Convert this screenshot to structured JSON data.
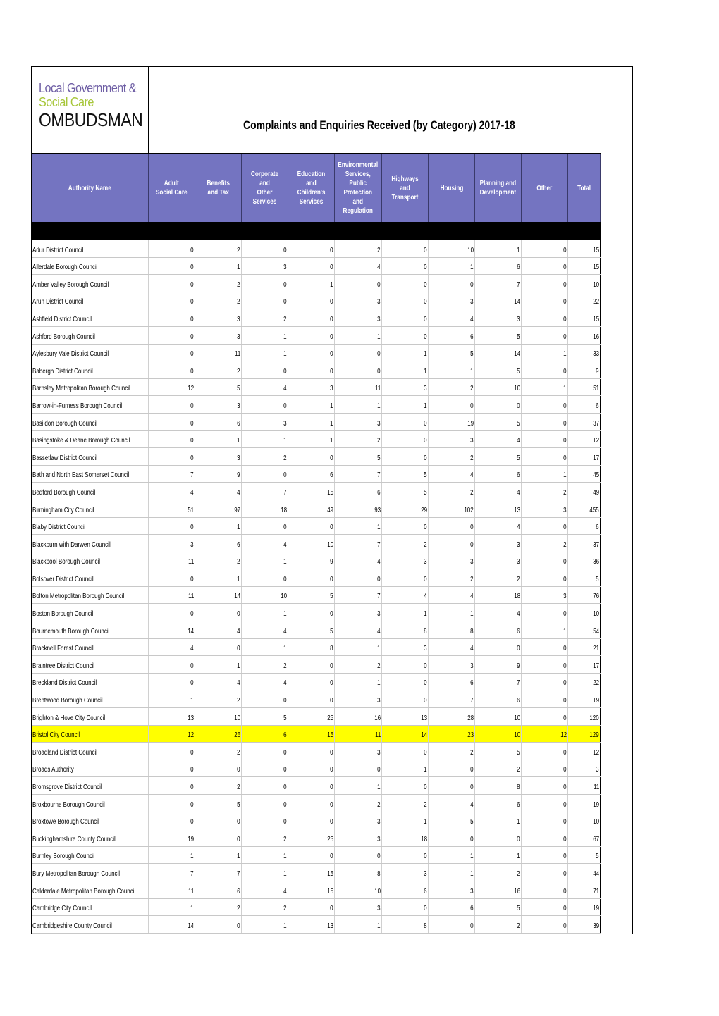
{
  "logo": {
    "line1": "Local Government &",
    "line2": "Social Care",
    "line3": "OMBUDSMAN",
    "colors": {
      "line1": "#6f5fa5",
      "line2": "#a7c63a",
      "line3": "#111111"
    }
  },
  "title": "Complaints and Enquiries Received (by Category) 2017-18",
  "colors": {
    "header_bg": "#7474c1",
    "highlight": "#ffff00"
  },
  "columns": [
    "Authority Name",
    "Adult Social Care",
    "Benefits and Tax",
    "Corporate and Other Services",
    "Education and Children's Services",
    "Environmental Services, Public Protection and Regulation",
    "Highways and Transport",
    "Housing",
    "Planning and Development",
    "Other",
    "Total"
  ],
  "rows": [
    {
      "name": "Adur District Council",
      "values": [
        0,
        2,
        0,
        0,
        2,
        0,
        10,
        1,
        0,
        15
      ]
    },
    {
      "name": "Allerdale Borough Council",
      "values": [
        0,
        1,
        3,
        0,
        4,
        0,
        1,
        6,
        0,
        15
      ]
    },
    {
      "name": "Amber Valley Borough Council",
      "values": [
        0,
        2,
        0,
        1,
        0,
        0,
        0,
        7,
        0,
        10
      ]
    },
    {
      "name": "Arun District Council",
      "values": [
        0,
        2,
        0,
        0,
        3,
        0,
        3,
        14,
        0,
        22
      ]
    },
    {
      "name": "Ashfield District Council",
      "values": [
        0,
        3,
        2,
        0,
        3,
        0,
        4,
        3,
        0,
        15
      ]
    },
    {
      "name": "Ashford Borough Council",
      "values": [
        0,
        3,
        1,
        0,
        1,
        0,
        6,
        5,
        0,
        16
      ]
    },
    {
      "name": "Aylesbury Vale District Council",
      "values": [
        0,
        11,
        1,
        0,
        0,
        1,
        5,
        14,
        1,
        33
      ]
    },
    {
      "name": "Babergh District Council",
      "values": [
        0,
        2,
        0,
        0,
        0,
        1,
        1,
        5,
        0,
        9
      ]
    },
    {
      "name": "Barnsley Metropolitan Borough Council",
      "values": [
        12,
        5,
        4,
        3,
        11,
        3,
        2,
        10,
        1,
        51
      ]
    },
    {
      "name": "Barrow-in-Furness Borough Council",
      "values": [
        0,
        3,
        0,
        1,
        1,
        1,
        0,
        0,
        0,
        6
      ]
    },
    {
      "name": "Basildon Borough Council",
      "values": [
        0,
        6,
        3,
        1,
        3,
        0,
        19,
        5,
        0,
        37
      ]
    },
    {
      "name": "Basingstoke & Deane Borough Council",
      "values": [
        0,
        1,
        1,
        1,
        2,
        0,
        3,
        4,
        0,
        12
      ]
    },
    {
      "name": "Bassetlaw District Council",
      "values": [
        0,
        3,
        2,
        0,
        5,
        0,
        2,
        5,
        0,
        17
      ]
    },
    {
      "name": "Bath and North East Somerset Council",
      "values": [
        7,
        9,
        0,
        6,
        7,
        5,
        4,
        6,
        1,
        45
      ]
    },
    {
      "name": "Bedford Borough Council",
      "values": [
        4,
        4,
        7,
        15,
        6,
        5,
        2,
        4,
        2,
        49
      ]
    },
    {
      "name": "Birmingham City Council",
      "values": [
        51,
        97,
        18,
        49,
        93,
        29,
        102,
        13,
        3,
        455
      ]
    },
    {
      "name": "Blaby District Council",
      "values": [
        0,
        1,
        0,
        0,
        1,
        0,
        0,
        4,
        0,
        6
      ]
    },
    {
      "name": "Blackburn with Darwen Council",
      "values": [
        3,
        6,
        4,
        10,
        7,
        2,
        0,
        3,
        2,
        37
      ]
    },
    {
      "name": "Blackpool Borough Council",
      "values": [
        11,
        2,
        1,
        9,
        4,
        3,
        3,
        3,
        0,
        36
      ]
    },
    {
      "name": "Bolsover District Council",
      "values": [
        0,
        1,
        0,
        0,
        0,
        0,
        2,
        2,
        0,
        5
      ]
    },
    {
      "name": "Bolton Metropolitan Borough Council",
      "values": [
        11,
        14,
        10,
        5,
        7,
        4,
        4,
        18,
        3,
        76
      ]
    },
    {
      "name": "Boston Borough Council",
      "values": [
        0,
        0,
        1,
        0,
        3,
        1,
        1,
        4,
        0,
        10
      ]
    },
    {
      "name": "Bournemouth Borough Council",
      "values": [
        14,
        4,
        4,
        5,
        4,
        8,
        8,
        6,
        1,
        54
      ]
    },
    {
      "name": "Bracknell Forest Council",
      "values": [
        4,
        0,
        1,
        8,
        1,
        3,
        4,
        0,
        0,
        21
      ]
    },
    {
      "name": "Braintree District Council",
      "values": [
        0,
        1,
        2,
        0,
        2,
        0,
        3,
        9,
        0,
        17
      ]
    },
    {
      "name": "Breckland District Council",
      "values": [
        0,
        4,
        4,
        0,
        1,
        0,
        6,
        7,
        0,
        22
      ]
    },
    {
      "name": "Brentwood Borough Council",
      "values": [
        1,
        2,
        0,
        0,
        3,
        0,
        7,
        6,
        0,
        19
      ]
    },
    {
      "name": "Brighton & Hove City Council",
      "values": [
        13,
        10,
        5,
        25,
        16,
        13,
        28,
        10,
        0,
        120
      ]
    },
    {
      "name": "Bristol City Council",
      "values": [
        12,
        26,
        6,
        15,
        11,
        14,
        23,
        10,
        12,
        129
      ],
      "highlighted": true
    },
    {
      "name": "Broadland District Council",
      "values": [
        0,
        2,
        0,
        0,
        3,
        0,
        2,
        5,
        0,
        12
      ]
    },
    {
      "name": "Broads Authority",
      "values": [
        0,
        0,
        0,
        0,
        0,
        1,
        0,
        2,
        0,
        3
      ]
    },
    {
      "name": "Bromsgrove District Council",
      "values": [
        0,
        2,
        0,
        0,
        1,
        0,
        0,
        8,
        0,
        11
      ]
    },
    {
      "name": "Broxbourne Borough Council",
      "values": [
        0,
        5,
        0,
        0,
        2,
        2,
        4,
        6,
        0,
        19
      ]
    },
    {
      "name": "Broxtowe Borough Council",
      "values": [
        0,
        0,
        0,
        0,
        3,
        1,
        5,
        1,
        0,
        10
      ]
    },
    {
      "name": "Buckinghamshire County Council",
      "values": [
        19,
        0,
        2,
        25,
        3,
        18,
        0,
        0,
        0,
        67
      ]
    },
    {
      "name": "Burnley Borough Council",
      "values": [
        1,
        1,
        1,
        0,
        0,
        0,
        1,
        1,
        0,
        5
      ]
    },
    {
      "name": "Bury Metropolitan Borough Council",
      "values": [
        7,
        7,
        1,
        15,
        8,
        3,
        1,
        2,
        0,
        44
      ]
    },
    {
      "name": "Calderdale Metropolitan Borough Council",
      "values": [
        11,
        6,
        4,
        15,
        10,
        6,
        3,
        16,
        0,
        71
      ]
    },
    {
      "name": "Cambridge City Council",
      "values": [
        1,
        2,
        2,
        0,
        3,
        0,
        6,
        5,
        0,
        19
      ]
    },
    {
      "name": "Cambridgeshire County Council",
      "values": [
        14,
        0,
        1,
        13,
        1,
        8,
        0,
        2,
        0,
        39
      ]
    }
  ]
}
